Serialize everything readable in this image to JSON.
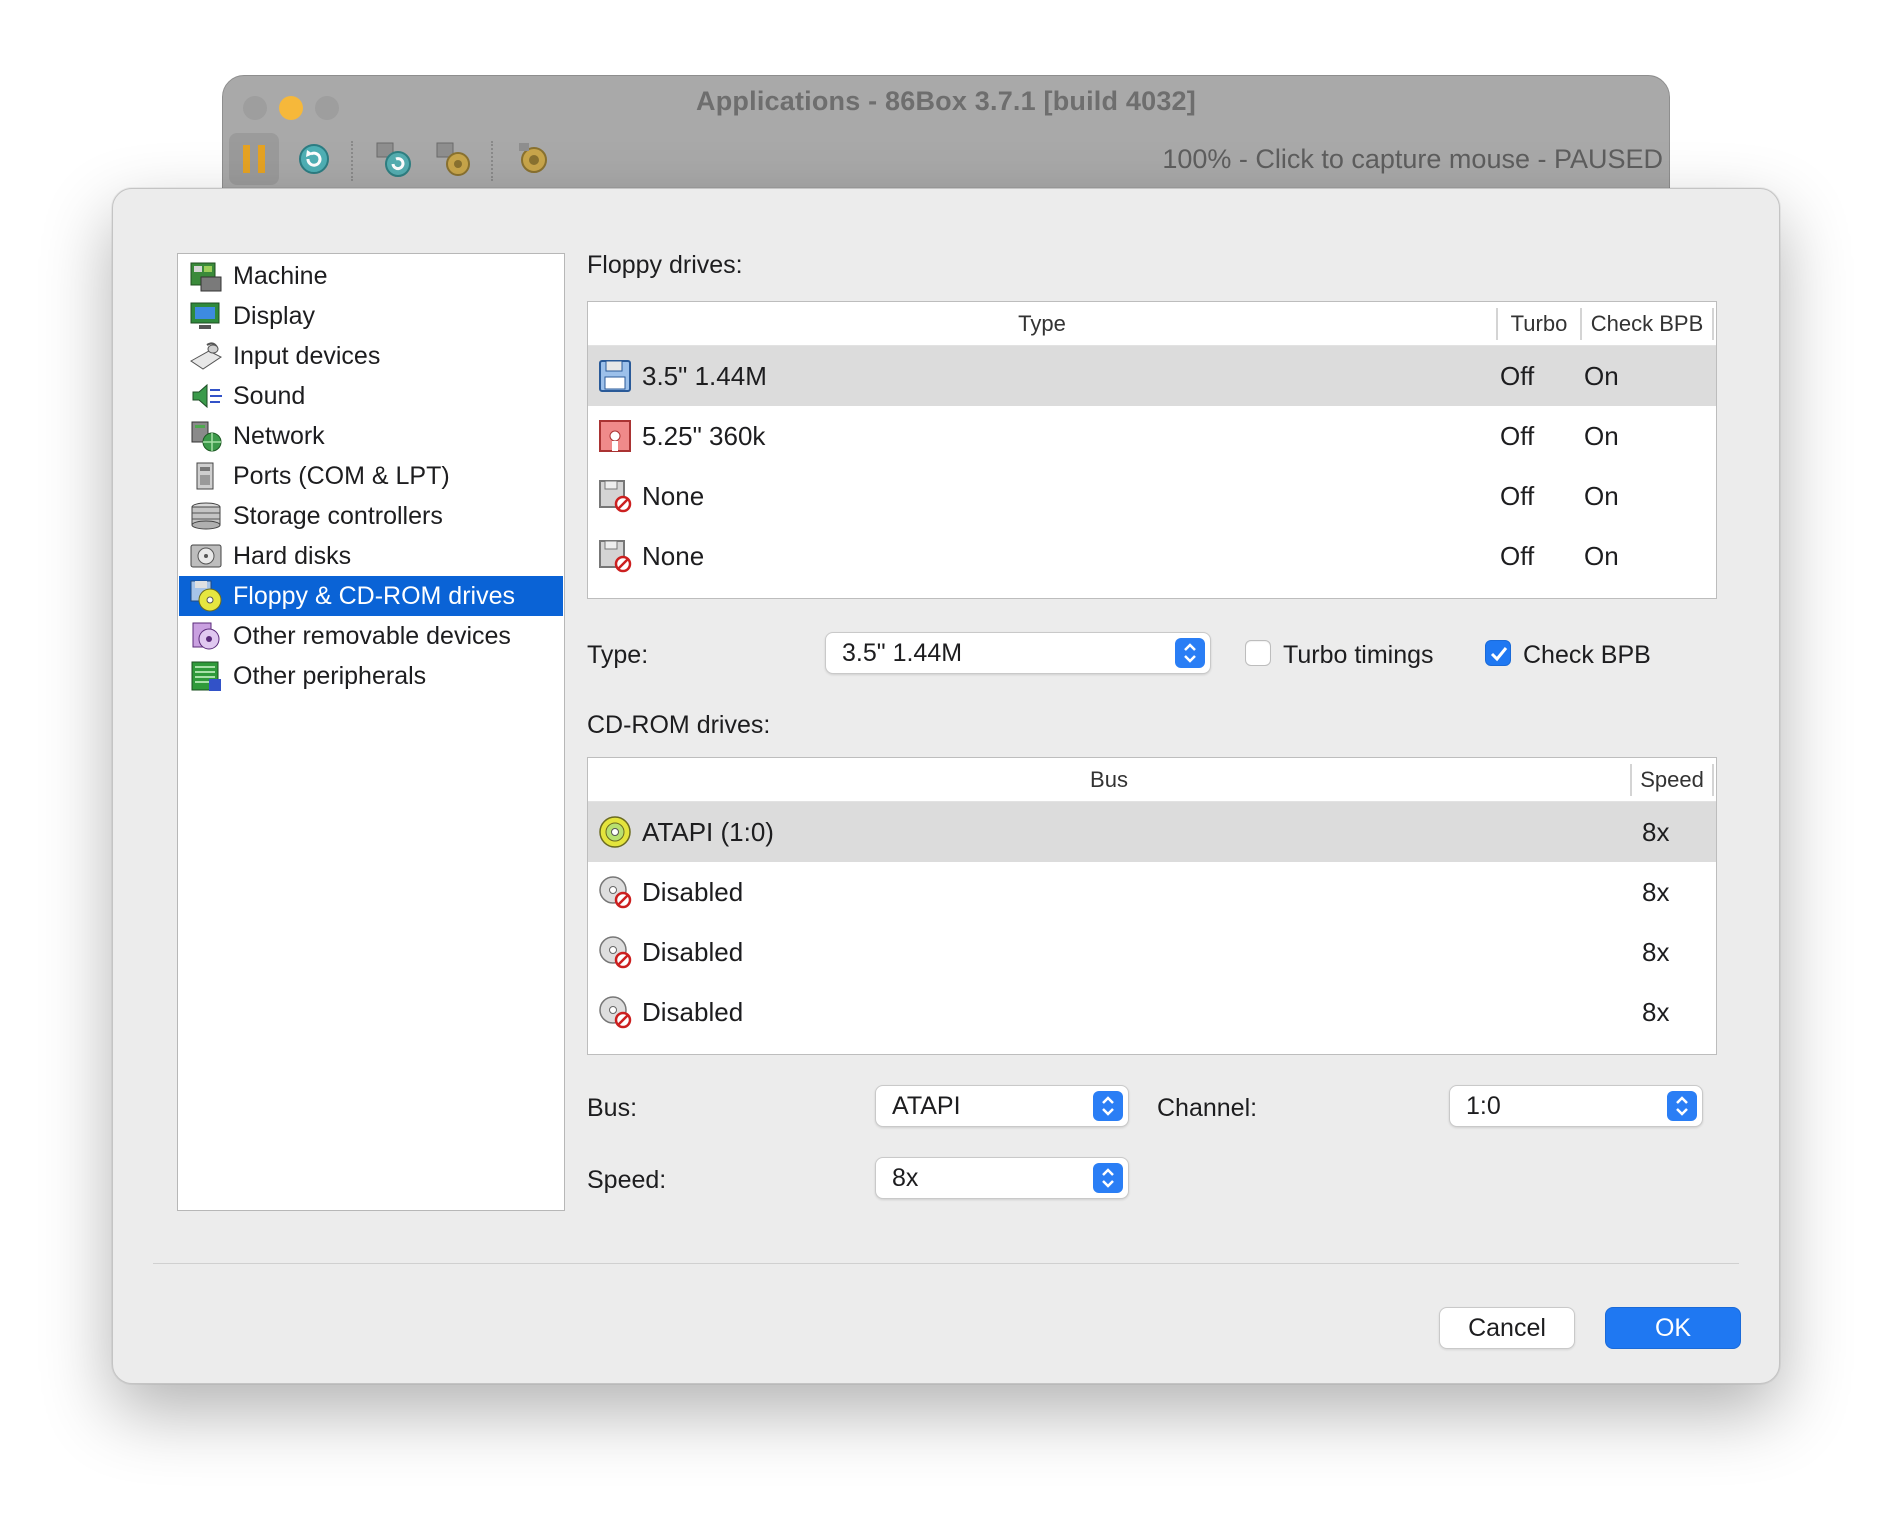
{
  "window": {
    "title": "Applications - 86Box 3.7.1 [build 4032]",
    "status": "100% - Click to capture mouse - PAUSED",
    "toolbar": [
      "pause-icon",
      "reset-icon",
      "ctrl-alt-del-icon",
      "ctrl-alt-esc-icon",
      "settings-icon"
    ]
  },
  "sidebar": {
    "items": [
      {
        "label": "Machine",
        "icon": "machine-icon"
      },
      {
        "label": "Display",
        "icon": "display-icon"
      },
      {
        "label": "Input devices",
        "icon": "input-devices-icon"
      },
      {
        "label": "Sound",
        "icon": "sound-icon"
      },
      {
        "label": "Network",
        "icon": "network-icon"
      },
      {
        "label": "Ports (COM & LPT)",
        "icon": "ports-icon"
      },
      {
        "label": "Storage controllers",
        "icon": "storage-controllers-icon"
      },
      {
        "label": "Hard disks",
        "icon": "hard-disk-icon"
      },
      {
        "label": "Floppy & CD-ROM drives",
        "icon": "floppy-cdrom-icon",
        "selected": true
      },
      {
        "label": "Other removable devices",
        "icon": "removable-devices-icon"
      },
      {
        "label": "Other peripherals",
        "icon": "peripherals-icon"
      }
    ]
  },
  "floppy": {
    "section_label": "Floppy drives:",
    "columns": {
      "type": "Type",
      "turbo": "Turbo",
      "check_bpb": "Check BPB"
    },
    "rows": [
      {
        "type": "3.5\" 1.44M",
        "turbo": "Off",
        "check_bpb": "On",
        "icon": "floppy-35-icon"
      },
      {
        "type": "5.25\" 360k",
        "turbo": "Off",
        "check_bpb": "On",
        "icon": "floppy-525-icon"
      },
      {
        "type": "None",
        "turbo": "Off",
        "check_bpb": "On",
        "icon": "floppy-disabled-icon"
      },
      {
        "type": "None",
        "turbo": "Off",
        "check_bpb": "On",
        "icon": "floppy-disabled-icon"
      }
    ],
    "type_label": "Type:",
    "type_value": "3.5\" 1.44M",
    "turbo_label": "Turbo timings",
    "turbo_checked": false,
    "check_bpb_label": "Check BPB",
    "check_bpb_checked": true
  },
  "cdrom": {
    "section_label": "CD-ROM drives:",
    "columns": {
      "bus": "Bus",
      "speed": "Speed"
    },
    "rows": [
      {
        "bus": "ATAPI (1:0)",
        "speed": "8x",
        "icon": "cdrom-icon"
      },
      {
        "bus": "Disabled",
        "speed": "8x",
        "icon": "cdrom-disabled-icon"
      },
      {
        "bus": "Disabled",
        "speed": "8x",
        "icon": "cdrom-disabled-icon"
      },
      {
        "bus": "Disabled",
        "speed": "8x",
        "icon": "cdrom-disabled-icon"
      }
    ],
    "bus_label": "Bus:",
    "bus_value": "ATAPI",
    "channel_label": "Channel:",
    "channel_value": "1:0",
    "speed_label": "Speed:",
    "speed_value": "8x"
  },
  "buttons": {
    "cancel": "Cancel",
    "ok": "OK"
  },
  "colors": {
    "accent": "#1f78f2",
    "selection": "#0a63d6"
  }
}
